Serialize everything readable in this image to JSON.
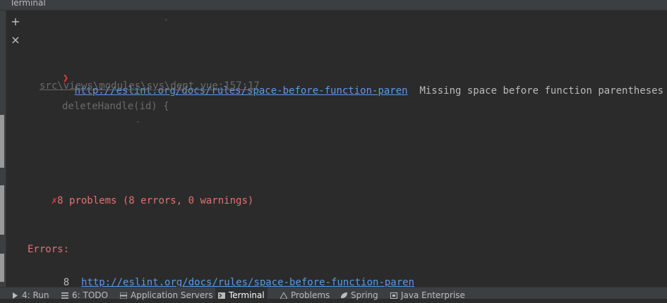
{
  "window": {
    "title": "Terminal"
  },
  "toolbar": {
    "new_session": "+",
    "close_session": "×"
  },
  "terminal": {
    "caret_top": "-",
    "error_marker": "❯",
    "rule_url": "http://eslint.org/docs/rules/space-before-function-paren",
    "rule_message": "Missing space before function parentheses",
    "file_location": "src\\views\\modules\\sys\\dept.vue:157:17",
    "code_line": "deleteHandle(id) {",
    "caret_bottom": "-",
    "summary_icon": "✗",
    "summary": "8 problems (8 errors, 0 warnings)",
    "errors_header": "Errors:",
    "error_count": "8",
    "errors_rule_url": "http://eslint.org/docs/rules/space-before-function-paren"
  },
  "bottom_tabs": [
    {
      "label": "4: Run",
      "icon": "run-icon"
    },
    {
      "label": "6: TODO",
      "icon": "todo-icon"
    },
    {
      "label": "Application Servers",
      "icon": "servers-icon"
    },
    {
      "label": "Terminal",
      "icon": "terminal-icon",
      "active": true
    },
    {
      "label": "Problems",
      "icon": "problems-icon"
    },
    {
      "label": "Spring",
      "icon": "spring-icon"
    },
    {
      "label": "Java Enterprise",
      "icon": "java-enterprise-icon"
    }
  ],
  "colors": {
    "background": "#2b2b2b",
    "link": "#5c9ae6",
    "error": "#e27272",
    "error_icon": "#e83b3b"
  }
}
